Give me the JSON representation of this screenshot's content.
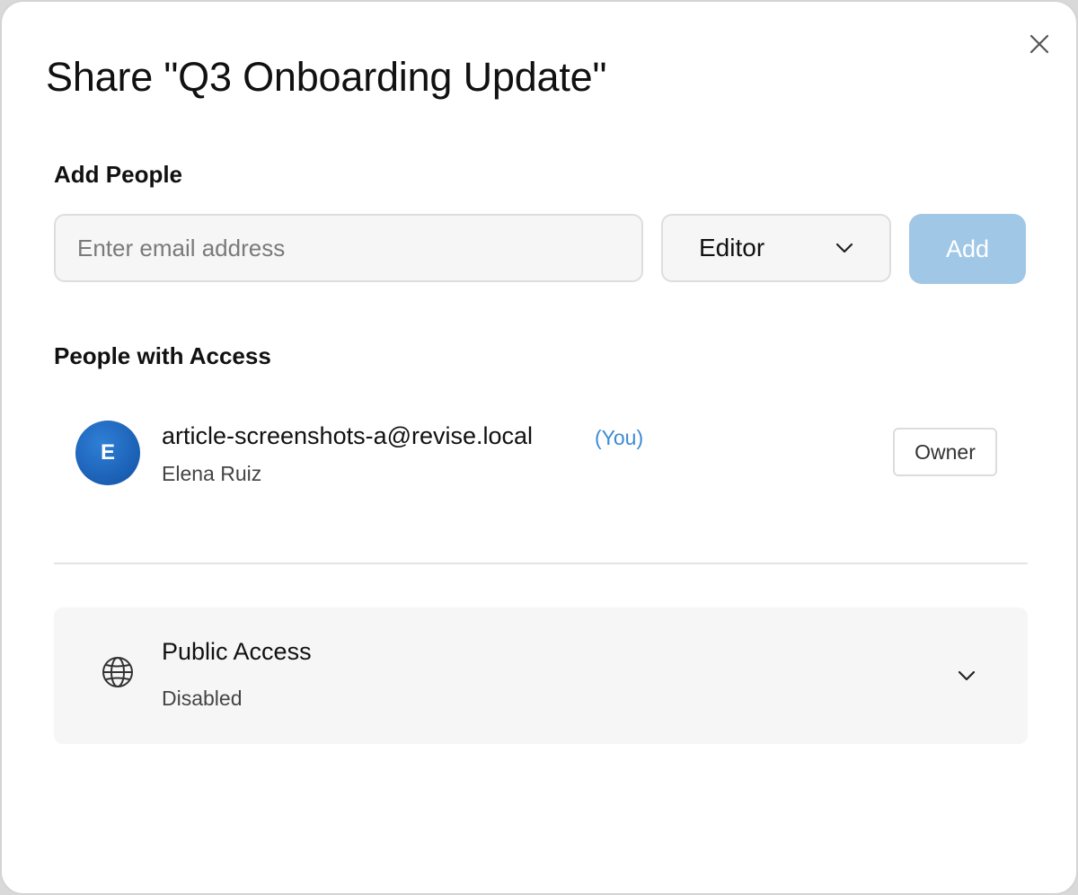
{
  "dialog": {
    "title": "Share \"Q3 Onboarding Update\"",
    "close_icon": "close-icon"
  },
  "add_people": {
    "label": "Add People",
    "email_placeholder": "Enter email address",
    "email_value": "",
    "role_selected": "Editor",
    "role_icon": "chevron-down-icon",
    "add_label": "Add",
    "add_color": "#a1c7e6"
  },
  "access": {
    "label": "People with Access",
    "people": [
      {
        "avatar_initial": "E",
        "email": "article-screenshots-a@revise.local",
        "you_tag": "(You)",
        "name": "Elena Ruiz",
        "role": "Owner"
      }
    ]
  },
  "public_access": {
    "icon": "globe-icon",
    "title": "Public Access",
    "status": "Disabled",
    "chevron_icon": "chevron-down-icon"
  },
  "colors": {
    "accent": "#3d8ad6",
    "avatar": "#1a5fb4",
    "panel_bg": "#f6f6f6"
  }
}
